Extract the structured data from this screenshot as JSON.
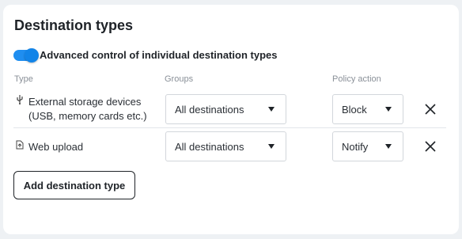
{
  "section": {
    "title": "Destination types"
  },
  "toggle": {
    "label": "Advanced control of individual destination types",
    "enabled": true,
    "accent_color": "#1f8ef0"
  },
  "table": {
    "headers": {
      "type": "Type",
      "groups": "Groups",
      "policy": "Policy action"
    },
    "rows": [
      {
        "type_icon": "usb-icon",
        "type_label": "External storage devices\n(USB, memory cards etc.)",
        "group": "All destinations",
        "policy": "Block"
      },
      {
        "type_icon": "upload-file-icon",
        "type_label": "Web upload",
        "group": "All destinations",
        "policy": "Notify"
      }
    ]
  },
  "actions": {
    "add_label": "Add destination type"
  }
}
